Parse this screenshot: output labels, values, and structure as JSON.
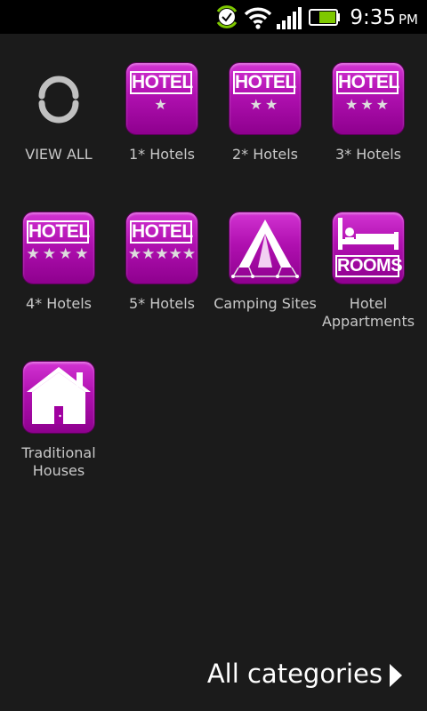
{
  "status_bar": {
    "time": "9:35",
    "ampm": "PM"
  },
  "categories": [
    {
      "label": "VIEW ALL"
    },
    {
      "label": "1* Hotels",
      "banner": "HOTEL",
      "stars": "★"
    },
    {
      "label": "2* Hotels",
      "banner": "HOTEL",
      "stars": "★★"
    },
    {
      "label": "3* Hotels",
      "banner": "HOTEL",
      "stars": "★★★"
    },
    {
      "label": "4* Hotels",
      "banner": "HOTEL",
      "stars": "★★★★"
    },
    {
      "label": "5* Hotels",
      "banner": "HOTEL",
      "stars": "★★★★★"
    },
    {
      "label": "Camping Sites"
    },
    {
      "label": "Hotel Appartments",
      "banner": "ROOMS"
    },
    {
      "label": "Traditional Houses"
    }
  ],
  "footer": {
    "all_categories_label": "All categories"
  },
  "colors": {
    "icon_purple": "#b010b0",
    "background": "#1b1b1b"
  }
}
